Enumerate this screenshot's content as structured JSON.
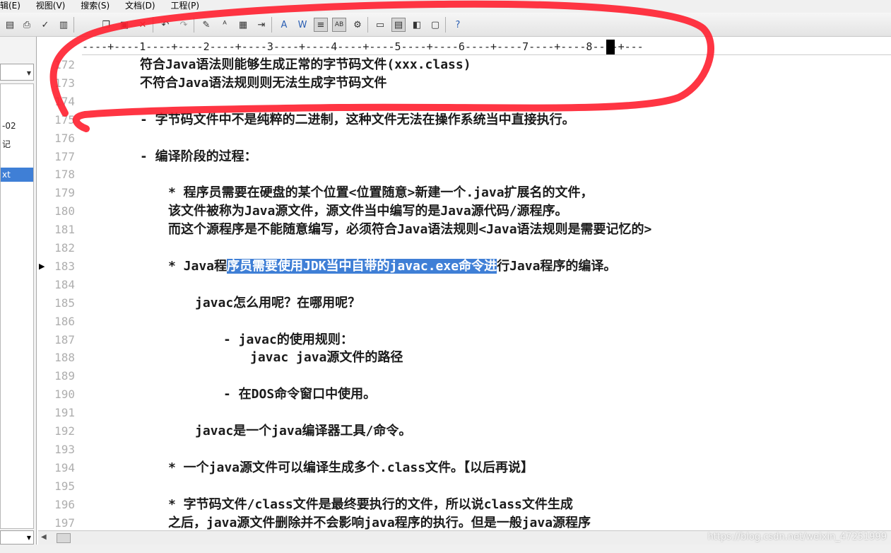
{
  "menu": [
    "辑(E)",
    "视图(V)",
    "搜索(S)",
    "文档(D)",
    "工程(P)"
  ],
  "ruler": "----+----1----+----2----+----3----+----4----+----5----+----6----+----7----+----8----+---",
  "left_panel": {
    "items": [
      {
        "label": "-02",
        "selected": false
      },
      {
        "label": "记",
        "selected": false
      },
      {
        "label": "xt",
        "selected": true
      }
    ]
  },
  "lines": [
    {
      "num": "172",
      "text": "符合Java语法则能够生成正常的字节码文件(xxx.class)",
      "indent": 144
    },
    {
      "num": "173",
      "text": "不符合Java语法规则则无法生成字节码文件",
      "indent": 144
    },
    {
      "num": "174",
      "text": "",
      "indent": 144
    },
    {
      "num": "175",
      "text": "- 字节码文件中不是纯粹的二进制，这种文件无法在操作系统当中直接执行。",
      "indent": 144
    },
    {
      "num": "176",
      "text": "",
      "indent": 144
    },
    {
      "num": "177",
      "text": "- 编译阶段的过程：",
      "indent": 144
    },
    {
      "num": "178",
      "text": "",
      "indent": 144
    },
    {
      "num": "179",
      "text": "* 程序员需要在硬盘的某个位置<位置随意>新建一个.java扩展名的文件，",
      "indent": 184
    },
    {
      "num": "180",
      "text": "该文件被称为Java源文件，源文件当中编写的是Java源代码/源程序。",
      "indent": 184
    },
    {
      "num": "181",
      "text": "而这个源程序是不能随意编写，必须符合Java语法规则<Java语法规则是需要记忆的>",
      "indent": 184
    },
    {
      "num": "182",
      "text": "",
      "indent": 184
    },
    {
      "num": "183",
      "text": "* Java程",
      "highlight": "序员需要使用JDK当中自带的javac.exe命令进",
      "after": "行Java程序的编译。",
      "indent": 184,
      "marker": true
    },
    {
      "num": "184",
      "text": "",
      "indent": 184
    },
    {
      "num": "185",
      "text": "javac怎么用呢？在哪用呢？",
      "indent": 222
    },
    {
      "num": "186",
      "text": "",
      "indent": 222
    },
    {
      "num": "187",
      "text": "- javac的使用规则：",
      "indent": 262
    },
    {
      "num": "188",
      "text": "javac java源文件的路径",
      "indent": 300
    },
    {
      "num": "189",
      "text": "",
      "indent": 262
    },
    {
      "num": "190",
      "text": "- 在DOS命令窗口中使用。",
      "indent": 262
    },
    {
      "num": "191",
      "text": "",
      "indent": 222
    },
    {
      "num": "192",
      "text": "javac是一个java编译器工具/命令。",
      "indent": 222
    },
    {
      "num": "193",
      "text": "",
      "indent": 184
    },
    {
      "num": "194",
      "text": "* 一个java源文件可以编译生成多个.class文件。【以后再说】",
      "indent": 184
    },
    {
      "num": "195",
      "text": "",
      "indent": 184
    },
    {
      "num": "196",
      "text": "* 字节码文件/class文件是最终要执行的文件，所以说class文件生成",
      "indent": 184
    },
    {
      "num": "197",
      "text": "之后，java源文件删除并不会影响java程序的执行。但是一般java源程序",
      "indent": 184
    }
  ],
  "watermark": "https://blog.csdn.net/weixin_47251999",
  "colors": {
    "selection": "#3f7fd6",
    "annotation": "#ff1f2f",
    "gutter": "#aeaeae"
  }
}
